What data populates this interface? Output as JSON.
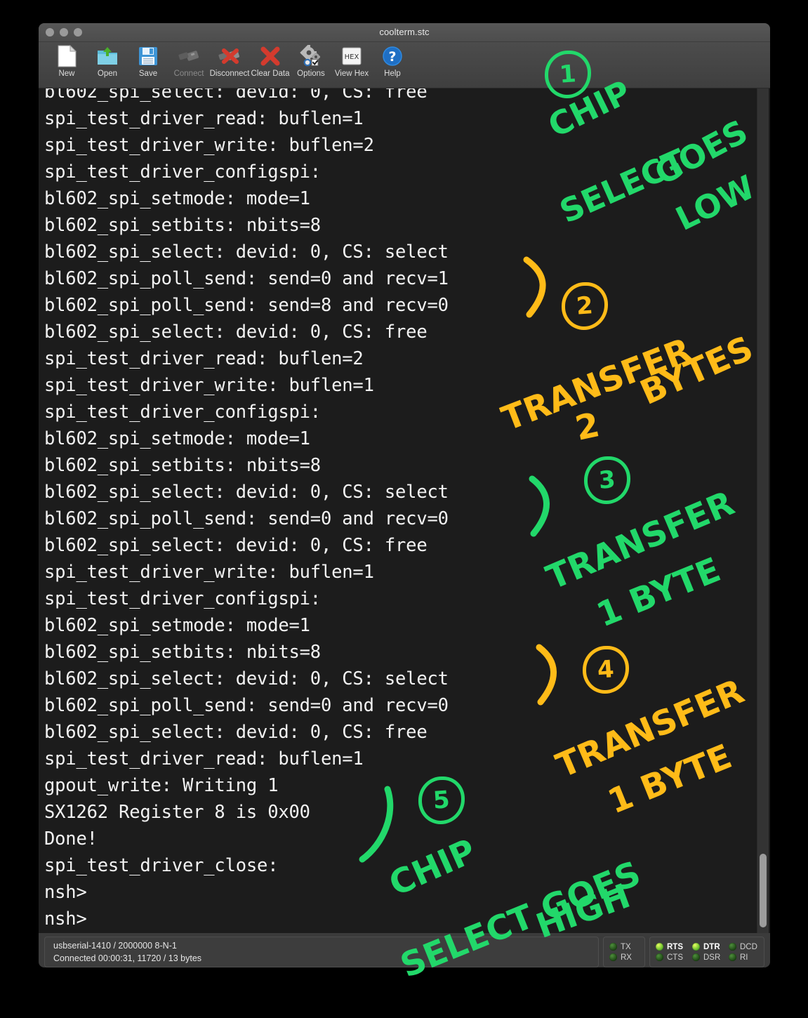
{
  "window": {
    "title": "coolterm.stc",
    "traffic_lights": [
      "close",
      "minimize",
      "zoom"
    ]
  },
  "toolbar": {
    "items": [
      {
        "label": "New",
        "icon": "new-document-icon",
        "enabled": true
      },
      {
        "label": "Open",
        "icon": "open-folder-icon",
        "enabled": true
      },
      {
        "label": "Save",
        "icon": "floppy-disk-icon",
        "enabled": true
      },
      {
        "label": "Connect",
        "icon": "usb-plug-icon",
        "enabled": false
      },
      {
        "label": "Disconnect",
        "icon": "usb-plug-x-icon",
        "enabled": true
      },
      {
        "label": "Clear Data",
        "icon": "red-x-icon",
        "enabled": true
      },
      {
        "label": "Options",
        "icon": "gears-icon",
        "enabled": true
      },
      {
        "label": "View Hex",
        "icon": "hex-icon",
        "enabled": true
      },
      {
        "label": "Help",
        "icon": "question-mark-icon",
        "enabled": true
      }
    ]
  },
  "terminal": {
    "lines": [
      "bl602_spi_select: devid: 0, CS: free",
      "spi_test_driver_read: buflen=1",
      "spi_test_driver_write: buflen=2",
      "spi_test_driver_configspi:",
      "bl602_spi_setmode: mode=1",
      "bl602_spi_setbits: nbits=8",
      "bl602_spi_select: devid: 0, CS: select",
      "bl602_spi_poll_send: send=0 and recv=1",
      "bl602_spi_poll_send: send=8 and recv=0",
      "bl602_spi_select: devid: 0, CS: free",
      "spi_test_driver_read: buflen=2",
      "spi_test_driver_write: buflen=1",
      "spi_test_driver_configspi:",
      "bl602_spi_setmode: mode=1",
      "bl602_spi_setbits: nbits=8",
      "bl602_spi_select: devid: 0, CS: select",
      "bl602_spi_poll_send: send=0 and recv=0",
      "bl602_spi_select: devid: 0, CS: free",
      "spi_test_driver_write: buflen=1",
      "spi_test_driver_configspi:",
      "bl602_spi_setmode: mode=1",
      "bl602_spi_setbits: nbits=8",
      "bl602_spi_select: devid: 0, CS: select",
      "bl602_spi_poll_send: send=0 and recv=0",
      "bl602_spi_select: devid: 0, CS: free",
      "spi_test_driver_read: buflen=1",
      "gpout_write: Writing 1",
      "SX1262 Register 8 is 0x00",
      "Done!",
      "spi_test_driver_close:",
      "nsh>",
      "nsh>"
    ]
  },
  "annotations": {
    "colors": {
      "green": "#22d86a",
      "orange": "#ffbb18"
    },
    "items": [
      {
        "number": "1",
        "color": "green",
        "text_lines": [
          "CHIP",
          "SELECT",
          "GOES",
          "LOW"
        ]
      },
      {
        "number": "2",
        "color": "orange",
        "text_lines": [
          "TRANSFER",
          "2",
          "BYTES"
        ]
      },
      {
        "number": "3",
        "color": "green",
        "text_lines": [
          "TRANSFER",
          "1 BYTE"
        ]
      },
      {
        "number": "4",
        "color": "orange",
        "text_lines": [
          "TRANSFER",
          "1 BYTE"
        ]
      },
      {
        "number": "5",
        "color": "green",
        "text_lines": [
          "CHIP",
          "SELECT GOES",
          "HIGH"
        ]
      }
    ],
    "a1": {
      "num": "1",
      "l1": "CHIP",
      "l2": "SELECT",
      "l3": "GOES",
      "l4": "LOW"
    },
    "a2": {
      "num": "2",
      "l1": "TRANSFER",
      "l2": "2",
      "l3": "BYTES"
    },
    "a3": {
      "num": "3",
      "l1": "TRANSFER",
      "l2": "1 BYTE"
    },
    "a4": {
      "num": "4",
      "l1": "TRANSFER",
      "l2": "1 BYTE"
    },
    "a5": {
      "num": "5",
      "l1": "CHIP",
      "l2": "SELECT GOES",
      "l3": "HIGH"
    }
  },
  "statusbar": {
    "port_line": "usbserial-1410 / 2000000 8-N-1",
    "connection_line": "Connected 00:00:31, 11720 / 13 bytes",
    "data_leds": [
      {
        "label": "TX",
        "on": false
      },
      {
        "label": "RX",
        "on": false
      }
    ],
    "signal_leds": [
      {
        "label": "RTS",
        "on": true
      },
      {
        "label": "CTS",
        "on": false
      },
      {
        "label": "DTR",
        "on": true
      },
      {
        "label": "DSR",
        "on": false
      },
      {
        "label": "DCD",
        "on": false
      },
      {
        "label": "RI",
        "on": false
      }
    ]
  }
}
